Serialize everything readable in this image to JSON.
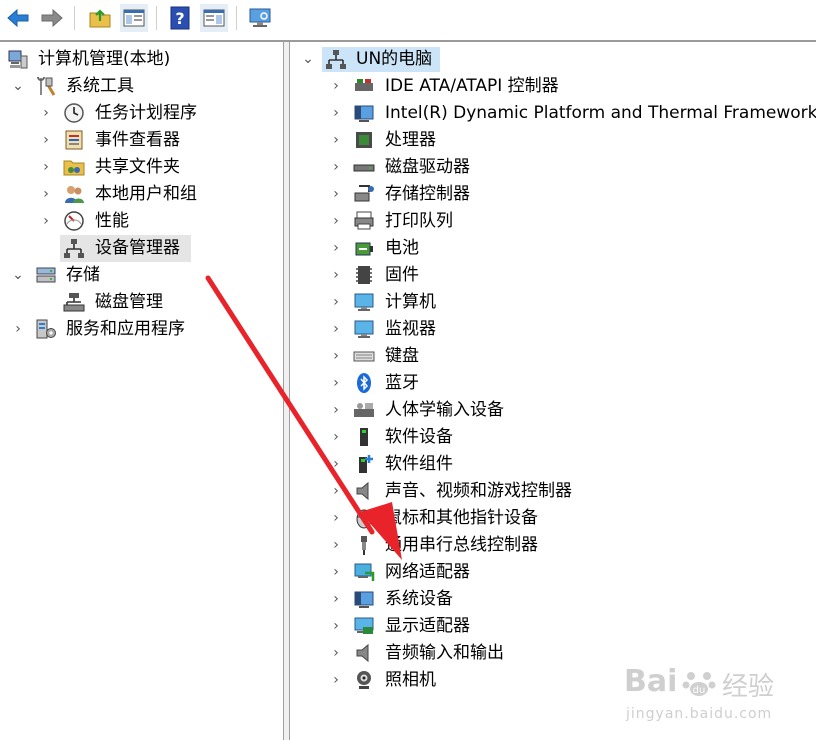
{
  "toolbar": {
    "buttons": [
      "back-icon",
      "forward-icon",
      "up-folder-icon",
      "show-hide-console-tree-icon",
      "help-icon",
      "show-action-pane-icon",
      "computer-monitor-icon"
    ]
  },
  "left_tree": {
    "root": "计算机管理(本地)",
    "system_tools": "系统工具",
    "task_scheduler": "任务计划程序",
    "event_viewer": "事件查看器",
    "shared_folders": "共享文件夹",
    "local_users": "本地用户和组",
    "performance": "性能",
    "device_manager": "设备管理器",
    "storage": "存储",
    "disk_management": "磁盘管理",
    "services": "服务和应用程序"
  },
  "right_tree": {
    "root": "UN的电脑",
    "items": [
      "IDE ATA/ATAPI 控制器",
      "Intel(R) Dynamic Platform and Thermal Framework",
      "处理器",
      "磁盘驱动器",
      "存储控制器",
      "打印队列",
      "电池",
      "固件",
      "计算机",
      "监视器",
      "键盘",
      "蓝牙",
      "人体学输入设备",
      "软件设备",
      "软件组件",
      "声音、视频和游戏控制器",
      "鼠标和其他指针设备",
      "通用串行总线控制器",
      "网络适配器",
      "系统设备",
      "显示适配器",
      "音频输入和输出",
      "照相机"
    ]
  },
  "watermark": {
    "brand": "Bai",
    "brand2": "经验",
    "url": "jingyan.baidu.com"
  },
  "colors": {
    "accent_blue": "#2a6ab8",
    "arrow_red": "#e8232a",
    "selection": "#e5e5e5",
    "root_highlight": "#cce4f7"
  }
}
